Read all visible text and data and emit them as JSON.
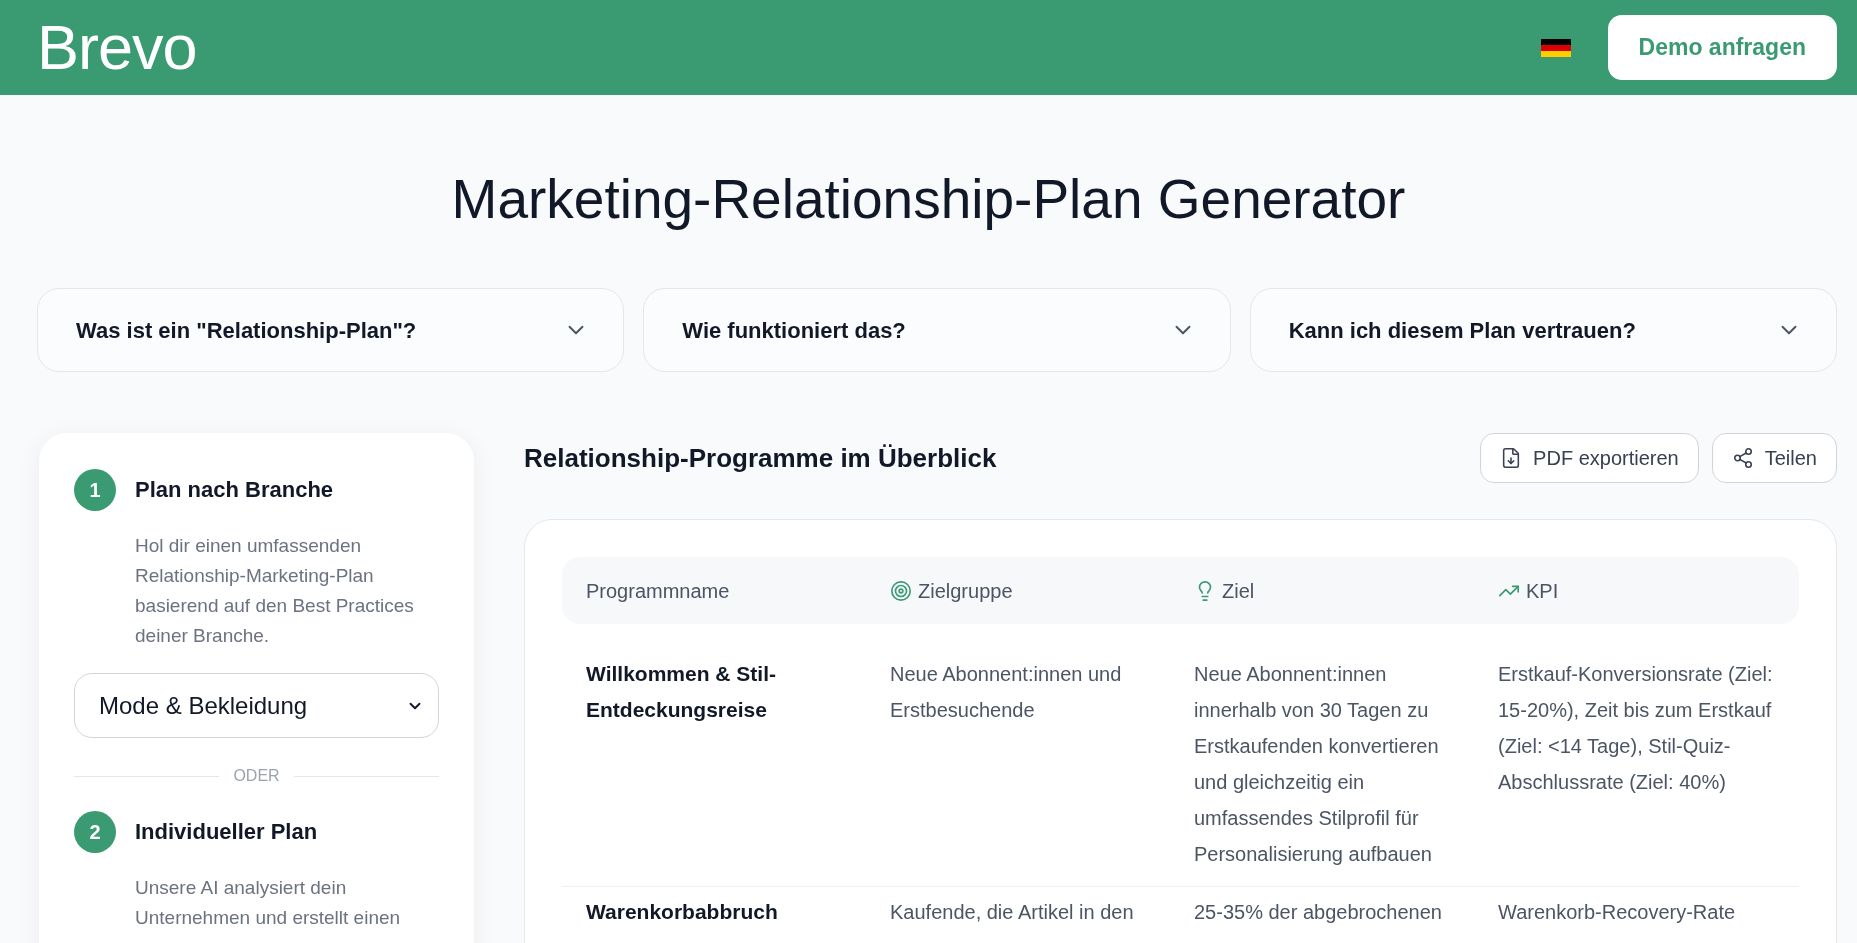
{
  "header": {
    "logo": "Brevo",
    "cta_button": "Demo anfragen"
  },
  "title": "Marketing-Relationship-Plan Generator",
  "faq": [
    {
      "question": "Was ist ein \"Relationship-Plan\"?",
      "expanded": false
    },
    {
      "question": "Wie funktioniert das?",
      "expanded": false
    },
    {
      "question": "Kann ich diesem Plan vertrauen?",
      "expanded": false
    }
  ],
  "plan_options": {
    "steps": [
      {
        "number": "1",
        "title": "Plan nach Branche",
        "description": "Hol dir einen umfassenden Relationship-Marketing-Plan basierend auf den Best Practices deiner Branche."
      },
      {
        "number": "2",
        "title": "Individueller Plan",
        "description": "Unsere AI analysiert dein Unternehmen und erstellt einen"
      }
    ],
    "industry_select": {
      "value": "Mode & Bekleidung"
    },
    "separator": "ODER"
  },
  "overview": {
    "title": "Relationship-Programme im Überblick",
    "export_button": "PDF exportieren",
    "share_button": "Teilen",
    "table": {
      "columns": [
        {
          "label": "Programmname"
        },
        {
          "label": "Zielgruppe"
        },
        {
          "label": "Ziel"
        },
        {
          "label": "KPI"
        }
      ],
      "rows": [
        {
          "cells": [
            "Willkommen & Stil-Entdeckungsreise",
            "Neue Abonnent:innen und Erstbesuchende",
            "Neue Abonnent:innen innerhalb von 30 Tagen zu Erstkaufenden konvertieren und gleichzeitig ein umfassendes Stilprofil für Personalisierung aufbauen",
            "Erstkauf-Konversionsrate (Ziel: 15-20%), Zeit bis zum Erstkauf (Ziel: <14 Tage), Stil-Quiz-Abschlussrate (Ziel: 40%)"
          ]
        },
        {
          "cells": [
            "Warenkorbabbruch",
            "Kaufende, die Artikel in den",
            "25-35% der abgebrochenen",
            "Warenkorb-Recovery-Rate"
          ]
        }
      ]
    }
  }
}
